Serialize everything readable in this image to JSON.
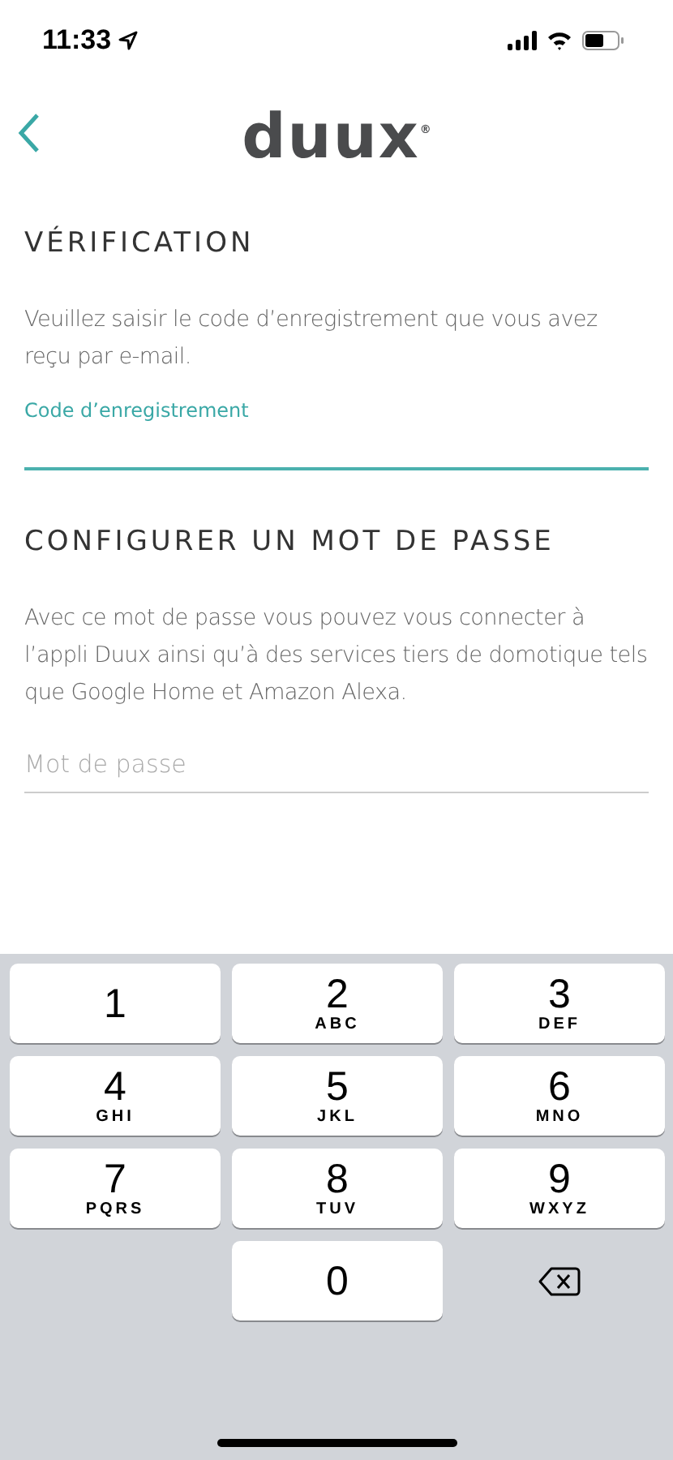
{
  "status_bar": {
    "time": "11:33"
  },
  "header": {
    "logo": "duux",
    "logo_mark": "®"
  },
  "sections": [
    {
      "title": "VÉRIFICATION",
      "text": "Veuillez saisir le code d’enregistrement que vous avez reçu par e-mail.",
      "field": {
        "label": "Code d’enregistrement",
        "focused": true
      }
    },
    {
      "title": "CONFIGURER UN MOT DE PASSE",
      "text": "Avec ce mot de passe vous pouvez vous connecter à l’appli Duux ainsi qu’à des services tiers de domotique tels que Google Home et Amazon Alexa.",
      "field": {
        "placeholder": "Mot de passe",
        "focused": false
      }
    }
  ],
  "keypad": {
    "keys": [
      {
        "kind": "digit",
        "digit": "1"
      },
      {
        "kind": "digit",
        "digit": "2",
        "letters": "ABC"
      },
      {
        "kind": "digit",
        "digit": "3",
        "letters": "DEF"
      },
      {
        "kind": "digit",
        "digit": "4",
        "letters": "GHI"
      },
      {
        "kind": "digit",
        "digit": "5",
        "letters": "JKL"
      },
      {
        "kind": "digit",
        "digit": "6",
        "letters": "MNO"
      },
      {
        "kind": "digit",
        "digit": "7",
        "letters": "PQRS"
      },
      {
        "kind": "digit",
        "digit": "8",
        "letters": "TUV"
      },
      {
        "kind": "digit",
        "digit": "9",
        "letters": "WXYZ"
      },
      {
        "kind": "blank"
      },
      {
        "kind": "digit",
        "digit": "0"
      },
      {
        "kind": "delete"
      }
    ]
  }
}
